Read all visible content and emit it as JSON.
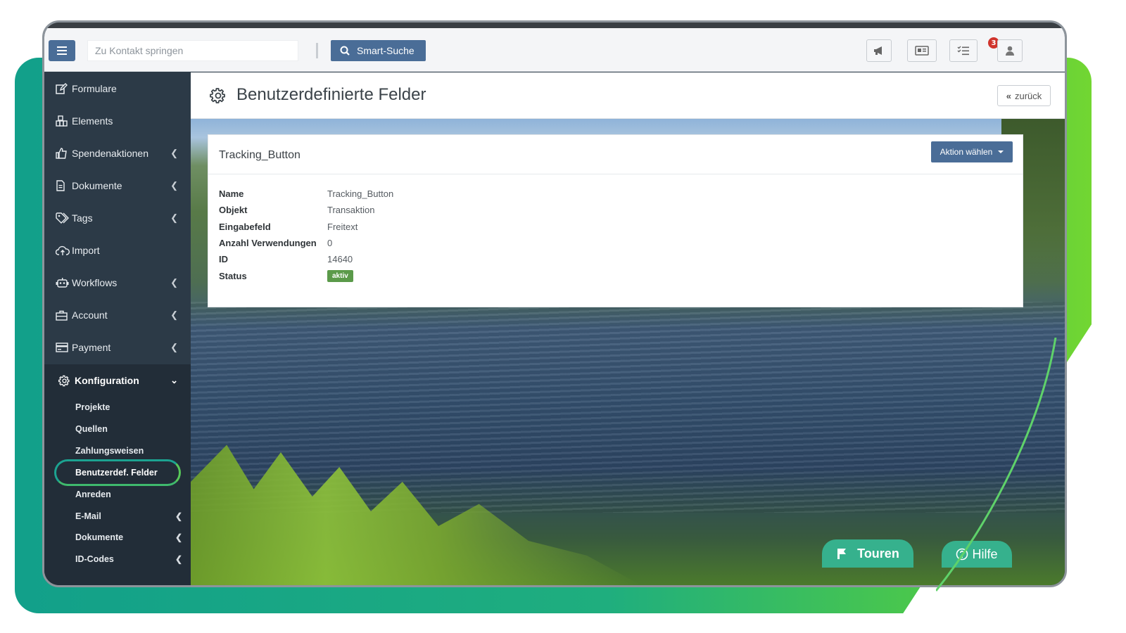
{
  "header": {
    "contact_placeholder": "Zu Kontakt springen",
    "smart_search_label": "Smart-Suche",
    "task_badge_count": "3"
  },
  "sidebar": {
    "items": [
      {
        "label": "Formulare",
        "icon": "edit-icon",
        "has_children": false
      },
      {
        "label": "Elements",
        "icon": "elements-icon",
        "has_children": false
      },
      {
        "label": "Spendenaktionen",
        "icon": "thumbs-up-icon",
        "has_children": true
      },
      {
        "label": "Dokumente",
        "icon": "document-icon",
        "has_children": true
      },
      {
        "label": "Tags",
        "icon": "tags-icon",
        "has_children": true
      },
      {
        "label": "Import",
        "icon": "cloud-upload-icon",
        "has_children": false
      },
      {
        "label": "Workflows",
        "icon": "robot-icon",
        "has_children": true
      },
      {
        "label": "Account",
        "icon": "briefcase-icon",
        "has_children": true
      },
      {
        "label": "Payment",
        "icon": "credit-card-icon",
        "has_children": true
      }
    ],
    "konfiguration": {
      "label": "Konfiguration",
      "sub_items": [
        {
          "label": "Projekte",
          "has_children": false
        },
        {
          "label": "Quellen",
          "has_children": false
        },
        {
          "label": "Zahlungsweisen",
          "has_children": false
        },
        {
          "label": "Benutzerdef. Felder",
          "has_children": false,
          "active": true
        },
        {
          "label": "Anreden",
          "has_children": false
        },
        {
          "label": "E-Mail",
          "has_children": true
        },
        {
          "label": "Dokumente",
          "has_children": true
        },
        {
          "label": "ID-Codes",
          "has_children": true
        }
      ]
    }
  },
  "page": {
    "title": "Benutzerdefinierte Felder",
    "back_label": "zurück"
  },
  "card": {
    "title": "Tracking_Button",
    "action_label": "Aktion wählen",
    "fields": [
      {
        "key": "Name",
        "value": "Tracking_Button"
      },
      {
        "key": "Objekt",
        "value": "Transaktion"
      },
      {
        "key": "Eingabefeld",
        "value": "Freitext"
      },
      {
        "key": "Anzahl Verwendungen",
        "value": "0"
      },
      {
        "key": "ID",
        "value": "14640"
      },
      {
        "key": "Status",
        "value": "aktiv",
        "pill": true
      }
    ]
  },
  "floating": {
    "touren_label": "Touren",
    "hilfe_label": "Hilfe"
  },
  "colors": {
    "primary": "#4a6d97",
    "sidebar": "#2c3a47",
    "accent_green": "#36b18d",
    "status_active": "#5b9a4a",
    "badge": "#d0342c"
  }
}
